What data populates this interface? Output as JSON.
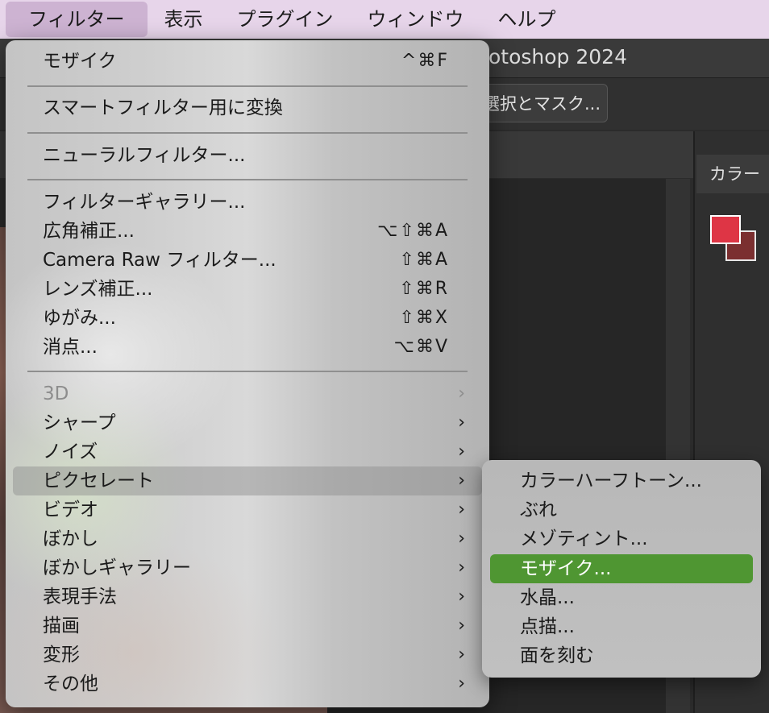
{
  "menubar": {
    "items": [
      {
        "label": "フィルター",
        "active": true
      },
      {
        "label": "表示"
      },
      {
        "label": "プラグイン"
      },
      {
        "label": "ウィンドウ"
      },
      {
        "label": "ヘルプ"
      }
    ]
  },
  "app": {
    "title_fragment": "otoshop 2024",
    "select_mask_label": "選択とマスク...",
    "color_panel_label": "カラー",
    "colors": {
      "foreground": "#de3545",
      "background": "#7b2f30",
      "menu_highlight": "#8c8c8c",
      "submenu_selected": "#4f9632"
    }
  },
  "filter_menu": {
    "items": [
      {
        "label": "モザイク",
        "shortcut": "^⌘F"
      },
      {
        "label": "スマートフィルター用に変換"
      },
      {
        "label": "ニューラルフィルター..."
      },
      {
        "label": "フィルターギャラリー..."
      },
      {
        "label": "広角補正...",
        "shortcut": "⌥⇧⌘A"
      },
      {
        "label": "Camera Raw フィルター...",
        "shortcut": "⇧⌘A"
      },
      {
        "label": "レンズ補正...",
        "shortcut": "⇧⌘R"
      },
      {
        "label": "ゆがみ...",
        "shortcut": "⇧⌘X"
      },
      {
        "label": "消点...",
        "shortcut": "⌥⌘V"
      },
      {
        "label": "3D",
        "submenu": true,
        "disabled": true
      },
      {
        "label": "シャープ",
        "submenu": true
      },
      {
        "label": "ノイズ",
        "submenu": true
      },
      {
        "label": "ピクセレート",
        "submenu": true,
        "highlighted": true
      },
      {
        "label": "ビデオ",
        "submenu": true
      },
      {
        "label": "ぼかし",
        "submenu": true
      },
      {
        "label": "ぼかしギャラリー",
        "submenu": true
      },
      {
        "label": "表現手法",
        "submenu": true
      },
      {
        "label": "描画",
        "submenu": true
      },
      {
        "label": "変形",
        "submenu": true
      },
      {
        "label": "その他",
        "submenu": true
      }
    ],
    "chevron": "›"
  },
  "pixelate_submenu": {
    "items": [
      {
        "label": "カラーハーフトーン..."
      },
      {
        "label": "ぶれ"
      },
      {
        "label": "メゾティント..."
      },
      {
        "label": "モザイク...",
        "selected": true
      },
      {
        "label": "水晶..."
      },
      {
        "label": "点描..."
      },
      {
        "label": "面を刻む"
      }
    ]
  }
}
